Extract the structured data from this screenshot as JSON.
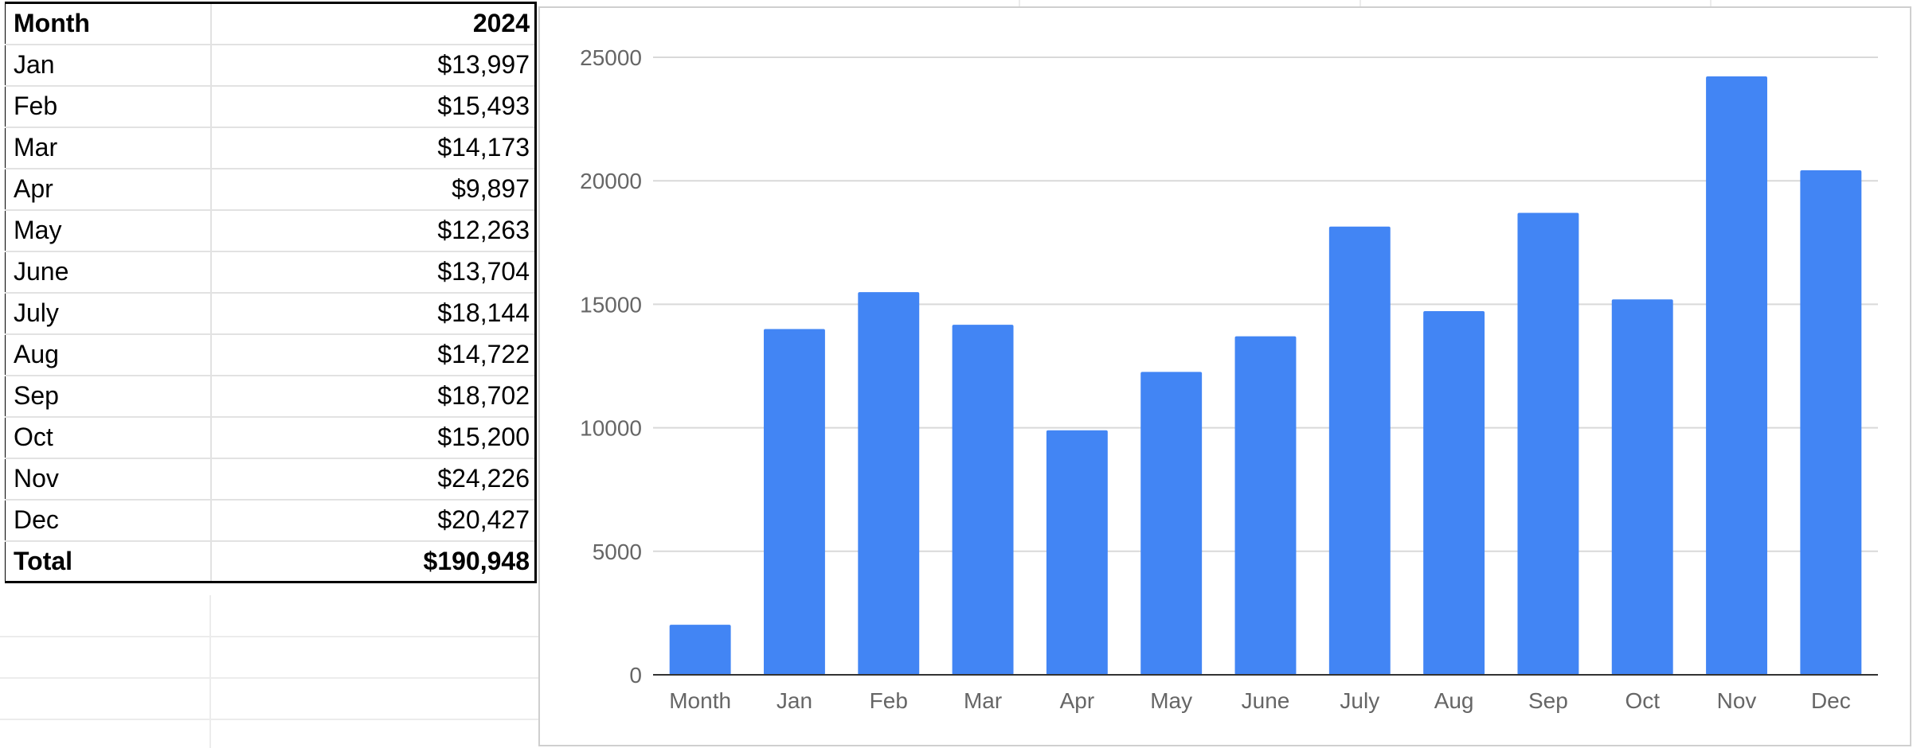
{
  "table": {
    "header": {
      "month": "Month",
      "year": "2024"
    },
    "rows": [
      {
        "month": "Jan",
        "value": "$13,997"
      },
      {
        "month": "Feb",
        "value": "$15,493"
      },
      {
        "month": "Mar",
        "value": "$14,173"
      },
      {
        "month": "Apr",
        "value": "$9,897"
      },
      {
        "month": "May",
        "value": "$12,263"
      },
      {
        "month": "June",
        "value": "$13,704"
      },
      {
        "month": "July",
        "value": "$18,144"
      },
      {
        "month": "Aug",
        "value": "$14,722"
      },
      {
        "month": "Sep",
        "value": "$18,702"
      },
      {
        "month": "Oct",
        "value": "$15,200"
      },
      {
        "month": "Nov",
        "value": "$24,226"
      },
      {
        "month": "Dec",
        "value": "$20,427"
      }
    ],
    "total": {
      "label": "Total",
      "value": "$190,948"
    }
  },
  "chart_data": {
    "type": "bar",
    "categories": [
      "Month",
      "Jan",
      "Feb",
      "Mar",
      "Apr",
      "May",
      "June",
      "July",
      "Aug",
      "Sep",
      "Oct",
      "Nov",
      "Dec"
    ],
    "values": [
      2024,
      13997,
      15493,
      14173,
      9897,
      12263,
      13704,
      18144,
      14722,
      18702,
      15200,
      24226,
      20427
    ],
    "ylim": [
      0,
      25000
    ],
    "yticks": [
      "0",
      "5000",
      "10000",
      "15000",
      "20000",
      "25000"
    ],
    "grid": true,
    "legend": "none",
    "bar_color": "#4285f4",
    "grid_color": "#d9d9d9",
    "axis_color": "#333333"
  }
}
